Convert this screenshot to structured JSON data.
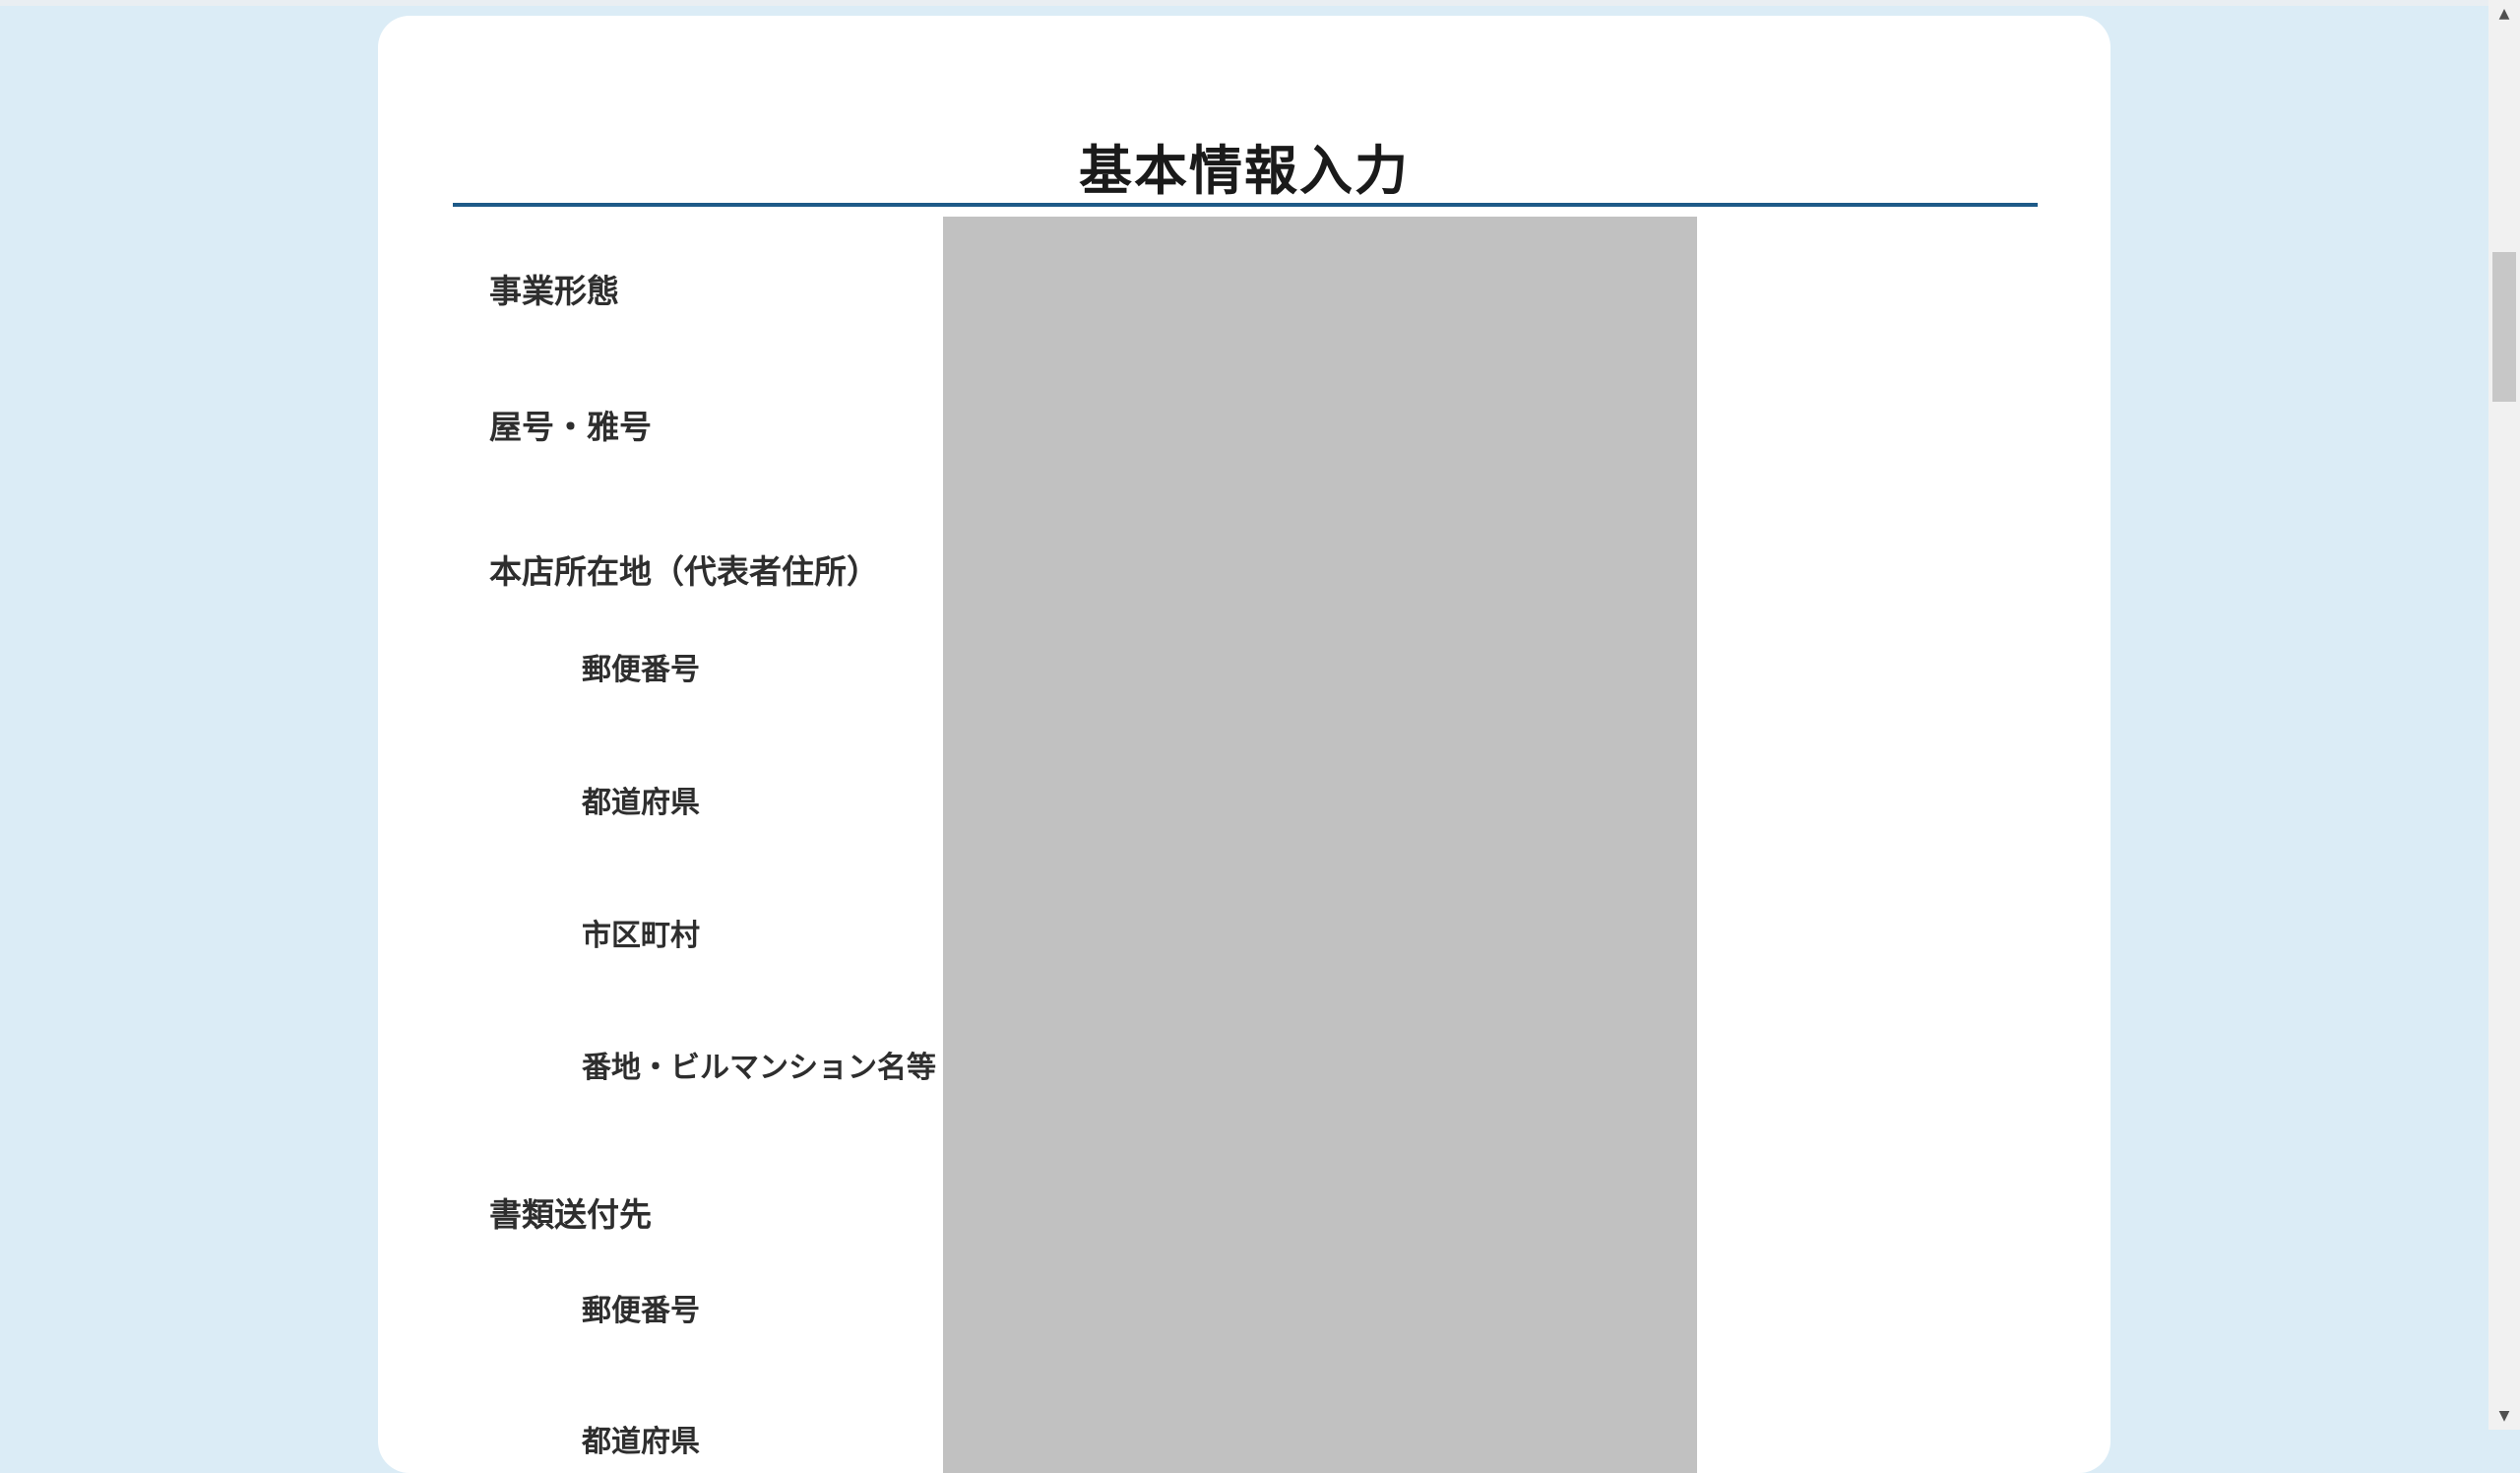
{
  "form": {
    "title": "基本情報入力",
    "fields": {
      "business_type": "事業形態",
      "trade_name": "屋号・雅号",
      "head_office_section": "本店所在地（代表者住所）",
      "head_office_postal_code": "郵便番号",
      "head_office_prefecture": "都道府県",
      "head_office_city": "市区町村",
      "head_office_address_detail": "番地・ビルマンション名等",
      "document_delivery_section": "書類送付先",
      "delivery_postal_code": "郵便番号",
      "delivery_prefecture": "都道府県"
    }
  },
  "scrollbar": {
    "up_arrow": "▲",
    "down_arrow": "▼"
  },
  "colors": {
    "page_background": "#dbecf6",
    "title_rule": "#1e5a88",
    "redaction": "#c1c1c1"
  }
}
